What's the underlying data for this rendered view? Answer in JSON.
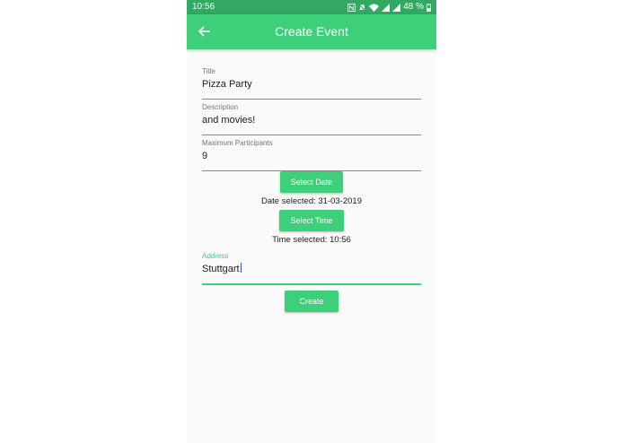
{
  "status_bar": {
    "time": "10:56",
    "battery": "48 %",
    "icons": [
      "nfc-icon",
      "mute-icon",
      "wifi-icon",
      "signal-icon",
      "signal-icon",
      "battery-icon"
    ]
  },
  "app_bar": {
    "title": "Create Event",
    "back_icon": "arrow-left-icon"
  },
  "form": {
    "title": {
      "label": "Title",
      "value": "Pizza Party"
    },
    "description": {
      "label": "Description",
      "value": "and movies!"
    },
    "max_participants": {
      "label": "Maximum Participants",
      "value": "9"
    },
    "select_date_label": "Select Date",
    "date_selected": "Date selected: 31-03-2019",
    "select_time_label": "Select Time",
    "time_selected": "Time selected: 10:56",
    "address": {
      "label": "Address",
      "value": "Stuttgart"
    },
    "create_label": "Create"
  },
  "colors": {
    "accent": "#3ecf7b",
    "status_bar": "#33a862",
    "background": "#fafafa",
    "caret": "#3f51b5"
  }
}
